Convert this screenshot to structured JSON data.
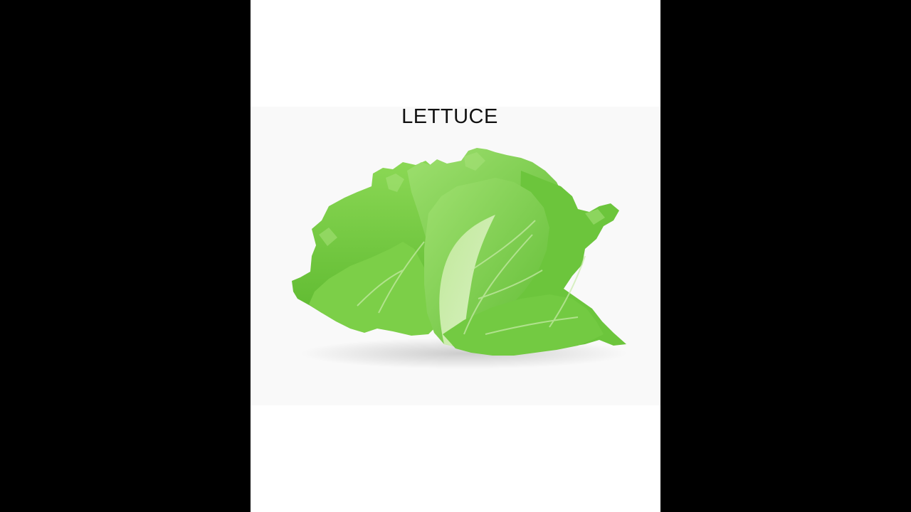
{
  "title": "LETTUCE",
  "colors": {
    "letterbox": "#000000",
    "background": "#ffffff",
    "leaf_dark": "#5cb82e",
    "leaf_mid": "#7fd14a",
    "leaf_light": "#a9e07c",
    "rib": "#d6efbf"
  },
  "image": {
    "subject": "lettuce-head"
  }
}
